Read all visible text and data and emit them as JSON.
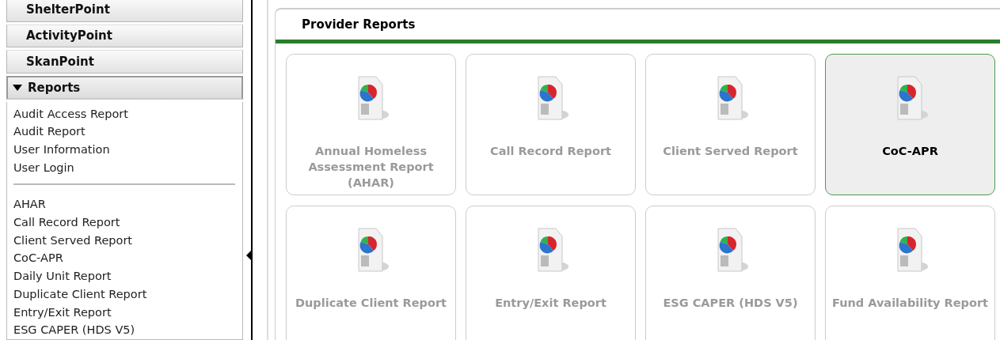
{
  "sidebar": {
    "sections": [
      {
        "label": "ShelterPoint",
        "expanded": false
      },
      {
        "label": "ActivityPoint",
        "expanded": false
      },
      {
        "label": "SkanPoint",
        "expanded": false
      },
      {
        "label": "Reports",
        "expanded": true
      }
    ],
    "report_groups": [
      [
        "Audit Access Report",
        "Audit Report",
        "User Information",
        "User Login"
      ],
      [
        "AHAR",
        "Call Record Report",
        "Client Served Report",
        "CoC-APR",
        "Daily Unit Report",
        "Duplicate Client Report",
        "Entry/Exit Report",
        "ESG CAPER (HDS V5)"
      ]
    ]
  },
  "panel": {
    "title": "Provider Reports",
    "tiles": [
      {
        "label": "Annual Homeless Assessment Report (AHAR)",
        "selected": false
      },
      {
        "label": "Call Record Report",
        "selected": false
      },
      {
        "label": "Client Served Report",
        "selected": false
      },
      {
        "label": "CoC-APR",
        "selected": true
      },
      {
        "label": "Duplicate Client Report",
        "selected": false
      },
      {
        "label": "Entry/Exit Report",
        "selected": false
      },
      {
        "label": "ESG CAPER (HDS V5)",
        "selected": false
      },
      {
        "label": "Fund Availability Report",
        "selected": false
      }
    ]
  }
}
